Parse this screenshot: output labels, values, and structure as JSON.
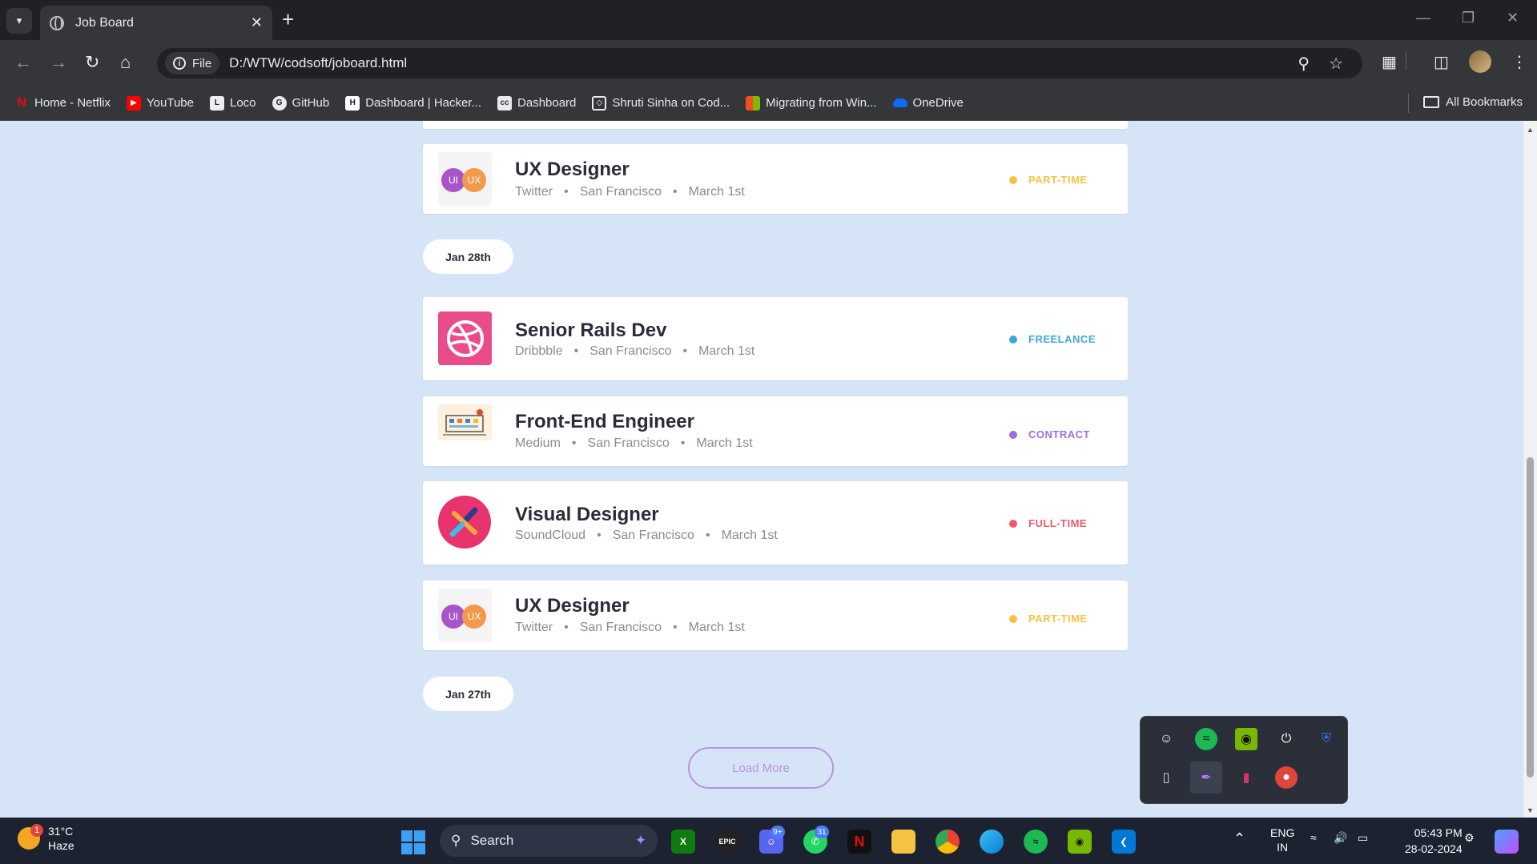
{
  "browser": {
    "tab_title": "Job Board",
    "file_chip": "File",
    "url": "D:/WTW/codsoft/joboard.html",
    "bookmarks": [
      {
        "label": "Home - Netflix",
        "icon": "netflix-icon",
        "color": "#e50914"
      },
      {
        "label": "YouTube",
        "icon": "youtube-icon",
        "color": "#ff0000"
      },
      {
        "label": "Loco",
        "icon": "loco-icon",
        "color": "#222222"
      },
      {
        "label": "GitHub",
        "icon": "github-icon",
        "color": "#e8eaed"
      },
      {
        "label": "Dashboard | Hacker...",
        "icon": "hackerrank-icon",
        "color": "#0e141e"
      },
      {
        "label": "Dashboard",
        "icon": "codechef-icon",
        "color": "#5f4b3a"
      },
      {
        "label": "Shruti Sinha on Cod...",
        "icon": "codepen-icon",
        "color": "#111111"
      },
      {
        "label": "Migrating from Win...",
        "icon": "microsoft-icon",
        "color": "#f25022"
      },
      {
        "label": "OneDrive",
        "icon": "onedrive-icon",
        "color": "#0a6cff"
      }
    ],
    "all_bookmarks": "All Bookmarks"
  },
  "page": {
    "jobs_top": [
      {
        "title": "UX Designer",
        "company": "Twitter",
        "location": "San Francisco",
        "date": "March 1st",
        "type": "PART-TIME",
        "type_color": "#f6c244",
        "logo": "uiux"
      }
    ],
    "date_1": "Jan 28th",
    "jobs_mid": [
      {
        "title": "Senior Rails Dev",
        "company": "Dribbble",
        "location": "San Francisco",
        "date": "March 1st",
        "type": "FREELANCE",
        "type_color": "#3fa8d4",
        "logo": "dribbble"
      },
      {
        "title": "Front-End Engineer",
        "company": "Medium",
        "location": "San Francisco",
        "date": "March 1st",
        "type": "CONTRACT",
        "type_color": "#9b6fe0",
        "logo": "medium"
      },
      {
        "title": "Visual Designer",
        "company": "SoundCloud",
        "location": "San Francisco",
        "date": "March 1st",
        "type": "FULL-TIME",
        "type_color": "#f0596a",
        "logo": "soundcloud"
      },
      {
        "title": "UX Designer",
        "company": "Twitter",
        "location": "San Francisco",
        "date": "March 1st",
        "type": "PART-TIME",
        "type_color": "#f6c244",
        "logo": "uiux"
      }
    ],
    "date_2": "Jan 27th",
    "load_more": "Load More",
    "logo_ui": "UI",
    "logo_ux": "UX",
    "bullet": "•"
  },
  "taskbar": {
    "weather_temp": "31°C",
    "weather_desc": "Haze",
    "weather_badge": "1",
    "search": "Search",
    "badge_discord": "9+",
    "badge_whatsapp": "31",
    "lang_1": "ENG",
    "lang_2": "IN",
    "time": "05:43 PM",
    "date": "28-02-2024"
  }
}
